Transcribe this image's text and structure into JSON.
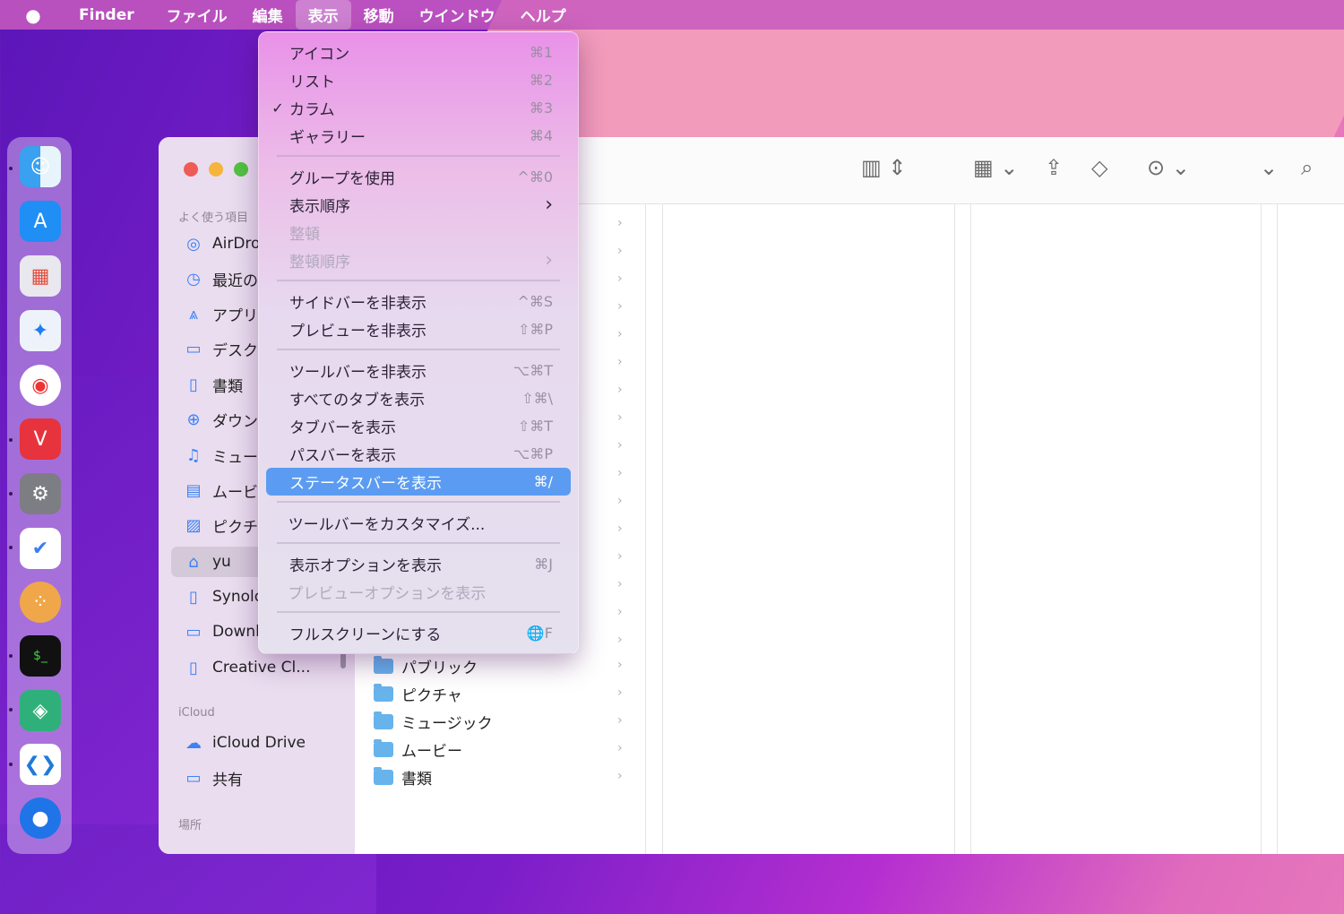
{
  "menubar": {
    "items": [
      {
        "label": "Finder"
      },
      {
        "label": "ファイル"
      },
      {
        "label": "編集"
      },
      {
        "label": "表示"
      },
      {
        "label": "移動"
      },
      {
        "label": "ウインドウ"
      },
      {
        "label": "ヘルプ"
      }
    ],
    "active": "表示"
  },
  "menu": {
    "items": [
      {
        "label": "アイコン",
        "shortcut": "⌘1"
      },
      {
        "label": "リスト",
        "shortcut": "⌘2"
      },
      {
        "label": "カラム",
        "shortcut": "⌘3",
        "check": "✓"
      },
      {
        "label": "ギャラリー",
        "shortcut": "⌘4"
      },
      {
        "label": "グループを使用",
        "shortcut": "^⌘0"
      },
      {
        "label": "表示順序",
        "shortcut": "›"
      },
      {
        "label": "整頓",
        "shortcut": "",
        "disabled": true
      },
      {
        "label": "整頓順序",
        "shortcut": "›",
        "disabled": true
      },
      {
        "label": "サイドバーを非表示",
        "shortcut": "^⌘S"
      },
      {
        "label": "プレビューを非表示",
        "shortcut": "⇧⌘P"
      },
      {
        "label": "ツールバーを非表示",
        "shortcut": "⌥⌘T"
      },
      {
        "label": "すべてのタブを表示",
        "shortcut": "⇧⌘\\"
      },
      {
        "label": "タブバーを表示",
        "shortcut": "⇧⌘T"
      },
      {
        "label": "パスバーを表示",
        "shortcut": "⌥⌘P"
      },
      {
        "label": "ステータスバーを表示",
        "shortcut": "⌘/",
        "highlighted": true
      },
      {
        "label": "ツールバーをカスタマイズ...",
        "shortcut": ""
      },
      {
        "label": "表示オプションを表示",
        "shortcut": "⌘J"
      },
      {
        "label": "プレビューオプションを表示",
        "shortcut": "",
        "disabled": true
      },
      {
        "label": "フルスクリーンにする",
        "shortcut": "🌐F"
      }
    ]
  },
  "sidebar": {
    "favorites_header": "よく使う項目",
    "items": [
      {
        "label": "AirDro",
        "icon": "airdrop-icon"
      },
      {
        "label": "最近の項",
        "icon": "clock-icon"
      },
      {
        "label": "アプリ",
        "icon": "apps-icon"
      },
      {
        "label": "デスク",
        "icon": "desktop-icon"
      },
      {
        "label": "書類",
        "icon": "document-icon"
      },
      {
        "label": "ダウン",
        "icon": "download-icon"
      },
      {
        "label": "ミュー",
        "icon": "music-icon"
      },
      {
        "label": "ムービ",
        "icon": "movie-icon"
      },
      {
        "label": "ピクチ",
        "icon": "picture-icon"
      },
      {
        "label": "yu",
        "icon": "home-icon",
        "selected": true
      },
      {
        "label": "Synolo",
        "icon": "document-icon"
      },
      {
        "label": "Downl",
        "icon": "folder-icon"
      },
      {
        "label": "Creative Cl...",
        "icon": "document-icon"
      }
    ],
    "icloud_header": "iCloud",
    "icloud_items": [
      {
        "label": "iCloud Drive",
        "icon": "cloud-icon"
      },
      {
        "label": "共有",
        "icon": "shared-folder-icon"
      }
    ],
    "places_header": "場所"
  },
  "column1": {
    "rows": [
      {
        "label": "パブリック"
      },
      {
        "label": "ピクチャ"
      },
      {
        "label": "ミュージック"
      },
      {
        "label": "ムービー"
      },
      {
        "label": "書類"
      }
    ]
  }
}
